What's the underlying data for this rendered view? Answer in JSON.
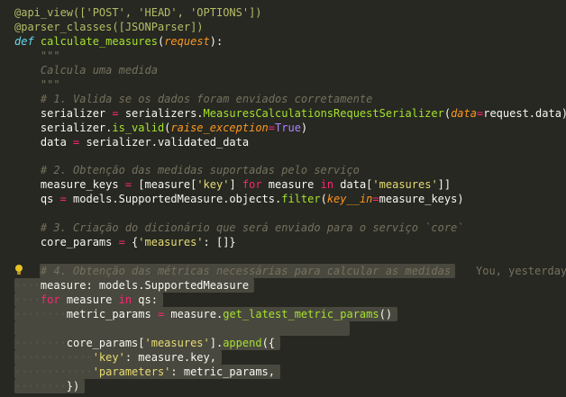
{
  "editor": {
    "colors": {
      "background": "#272822",
      "comment": "#75715e",
      "string": "#e6db74",
      "keyword": "#f92672",
      "function": "#a6e22e"
    },
    "lines": [
      {
        "parts": [
          "@api_view(['POST', 'HEAD', 'OPTIONS'])"
        ]
      },
      {
        "parts": [
          "@parser_classes([JSONParser])"
        ]
      },
      {
        "parts": [
          "def",
          " ",
          "calculate_measures",
          "(",
          "request",
          "):"
        ]
      },
      {
        "parts": [
          "    \"\"\""
        ]
      },
      {
        "parts": [
          "    Calcula uma medida"
        ]
      },
      {
        "parts": [
          "    \"\"\""
        ]
      },
      {
        "parts": [
          "    # 1. Valida se os dados foram enviados corretamente"
        ]
      },
      {
        "parts": [
          "    serializer ",
          "=",
          " serializers.",
          "MeasuresCalculationsRequestSerializer",
          "(",
          "data",
          "=",
          "request.data)"
        ]
      },
      {
        "parts": [
          "    serializer.",
          "is_valid",
          "(",
          "raise_exception",
          "=",
          "True",
          ")"
        ]
      },
      {
        "parts": [
          "    data ",
          "=",
          " serializer.validated_data"
        ]
      },
      {
        "parts": [
          ""
        ]
      },
      {
        "parts": [
          "    # 2. Obtenção das medidas suportadas pelo serviço"
        ]
      },
      {
        "parts": [
          "    measure_keys ",
          "=",
          " [measure[",
          "'key'",
          "] ",
          "for",
          " measure ",
          "in",
          " data[",
          "'measures'",
          "]]"
        ]
      },
      {
        "parts": [
          "    qs ",
          "=",
          " models.SupportedMeasure.objects.",
          "filter",
          "(",
          "key__in",
          "=",
          "measure_keys)"
        ]
      },
      {
        "parts": [
          ""
        ]
      },
      {
        "parts": [
          "    # 3. Criação do dicionário que será enviado para o serviço `core`"
        ]
      },
      {
        "parts": [
          "    core_params ",
          "=",
          " {",
          "'measures'",
          ": []}"
        ]
      },
      {
        "parts": [
          ""
        ]
      },
      {
        "parts": [
          "    # 4. Obtenção das métricas necessárias para calcular as medidas"
        ],
        "blame": "You, yesterday"
      },
      {
        "parts": [
          "····",
          "measure",
          ": models.SupportedMeasure"
        ]
      },
      {
        "parts": [
          "····",
          "for",
          " measure ",
          "in",
          " qs:"
        ]
      },
      {
        "parts": [
          "········",
          "metric_params ",
          "=",
          " measure.",
          "get_latest_metric_params",
          "()"
        ]
      },
      {
        "parts": [
          ""
        ]
      },
      {
        "parts": [
          "········",
          "core_params[",
          "'measures'",
          "].",
          "append",
          "({"
        ]
      },
      {
        "parts": [
          "············",
          "'key'",
          ": measure.key,"
        ]
      },
      {
        "parts": [
          "············",
          "'parameters'",
          ": metric_params,"
        ]
      },
      {
        "parts": [
          "········",
          "})"
        ]
      }
    ]
  }
}
